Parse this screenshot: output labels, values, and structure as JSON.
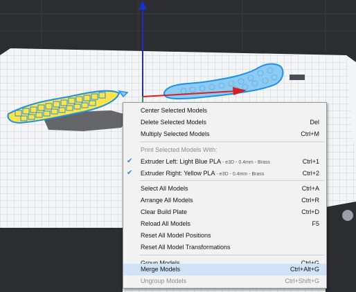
{
  "menu": {
    "items": [
      {
        "label": "Center Selected Models",
        "shortcut": ""
      },
      {
        "label": "Delete Selected Models",
        "shortcut": "Del"
      },
      {
        "label": "Multiply Selected Models",
        "shortcut": "Ctrl+M"
      },
      {
        "label": "Print Selected Models With:",
        "shortcut": ""
      },
      {
        "label": "Extruder Left: Light Blue PLA",
        "detail": " - e3D - 0.4mm - Brass",
        "shortcut": "Ctrl+1"
      },
      {
        "label": "Extruder Right: Yellow PLA",
        "detail": " - e3D - 0.4mm - Brass",
        "shortcut": "Ctrl+2"
      },
      {
        "label": "Select All Models",
        "shortcut": "Ctrl+A"
      },
      {
        "label": "Arrange All Models",
        "shortcut": "Ctrl+R"
      },
      {
        "label": "Clear Build Plate",
        "shortcut": "Ctrl+D"
      },
      {
        "label": "Reload All Models",
        "shortcut": "F5"
      },
      {
        "label": "Reset All Model Positions",
        "shortcut": ""
      },
      {
        "label": "Reset All Model Transformations",
        "shortcut": ""
      },
      {
        "label": "Group Models",
        "shortcut": "Ctrl+G"
      },
      {
        "label": "Merge Models",
        "shortcut": "Ctrl+Alt+G"
      },
      {
        "label": "Ungroup Models",
        "shortcut": "Ctrl+Shift+G"
      }
    ]
  },
  "colors": {
    "background": "#2c2d30",
    "build_plate": "#f4f5f7",
    "grid_line": "#c5c8cc",
    "model_blue": "#8ecbf2",
    "model_yellow": "#ffe34a",
    "model_outline": "#1e90e6",
    "highlight": "#cfe2f7",
    "axis_x": "#d42020",
    "axis_y": "#1a30c0",
    "axis_z": "#20a040"
  },
  "icons": [
    "checkmark-icon"
  ]
}
